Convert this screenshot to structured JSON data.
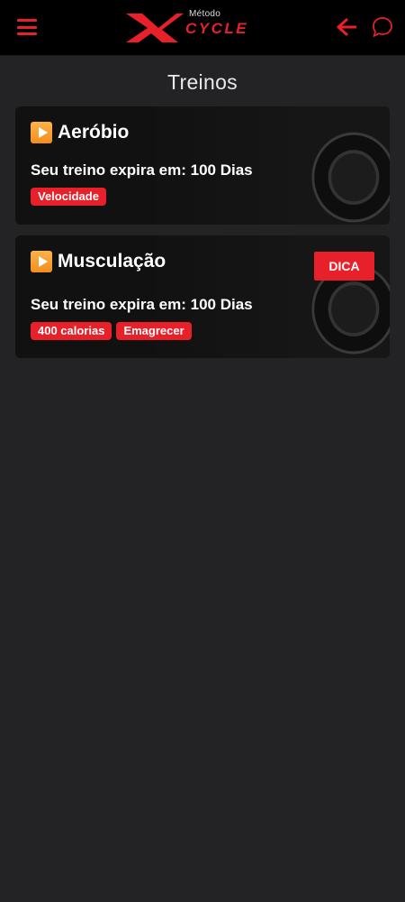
{
  "app": {
    "logo_small": "Método",
    "logo_brand": "CYCLE"
  },
  "page": {
    "title": "Treinos"
  },
  "cards": [
    {
      "title": "Aeróbio",
      "expire_text": "Seu treino expira em: 100 Dias",
      "tags": [
        "Velocidade"
      ]
    },
    {
      "title": "Musculação",
      "expire_text": "Seu treino expira em: 100 Dias",
      "badge": "DICA",
      "tags": [
        "400 calorias",
        "Emagrecer"
      ]
    }
  ],
  "colors": {
    "accent": "#e8202a",
    "background": "#232224",
    "appbar": "#000000"
  },
  "icons": [
    "menu-icon",
    "arrow-left-icon",
    "chat-bubble-icon",
    "play-icon"
  ]
}
